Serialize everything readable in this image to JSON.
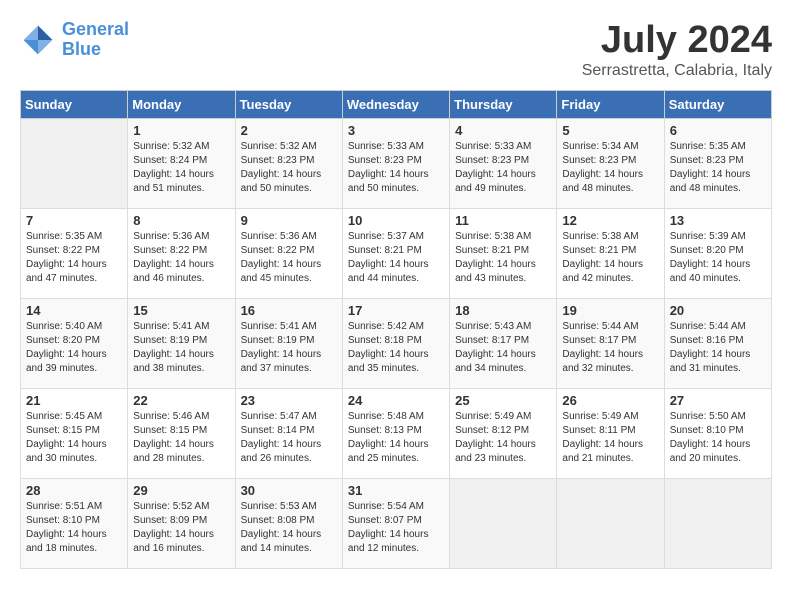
{
  "logo": {
    "line1": "General",
    "line2": "Blue"
  },
  "title": "July 2024",
  "subtitle": "Serrastretta, Calabria, Italy",
  "headers": [
    "Sunday",
    "Monday",
    "Tuesday",
    "Wednesday",
    "Thursday",
    "Friday",
    "Saturday"
  ],
  "weeks": [
    [
      {
        "day": "",
        "info": ""
      },
      {
        "day": "1",
        "info": "Sunrise: 5:32 AM\nSunset: 8:24 PM\nDaylight: 14 hours\nand 51 minutes."
      },
      {
        "day": "2",
        "info": "Sunrise: 5:32 AM\nSunset: 8:23 PM\nDaylight: 14 hours\nand 50 minutes."
      },
      {
        "day": "3",
        "info": "Sunrise: 5:33 AM\nSunset: 8:23 PM\nDaylight: 14 hours\nand 50 minutes."
      },
      {
        "day": "4",
        "info": "Sunrise: 5:33 AM\nSunset: 8:23 PM\nDaylight: 14 hours\nand 49 minutes."
      },
      {
        "day": "5",
        "info": "Sunrise: 5:34 AM\nSunset: 8:23 PM\nDaylight: 14 hours\nand 48 minutes."
      },
      {
        "day": "6",
        "info": "Sunrise: 5:35 AM\nSunset: 8:23 PM\nDaylight: 14 hours\nand 48 minutes."
      }
    ],
    [
      {
        "day": "7",
        "info": "Sunrise: 5:35 AM\nSunset: 8:22 PM\nDaylight: 14 hours\nand 47 minutes."
      },
      {
        "day": "8",
        "info": "Sunrise: 5:36 AM\nSunset: 8:22 PM\nDaylight: 14 hours\nand 46 minutes."
      },
      {
        "day": "9",
        "info": "Sunrise: 5:36 AM\nSunset: 8:22 PM\nDaylight: 14 hours\nand 45 minutes."
      },
      {
        "day": "10",
        "info": "Sunrise: 5:37 AM\nSunset: 8:21 PM\nDaylight: 14 hours\nand 44 minutes."
      },
      {
        "day": "11",
        "info": "Sunrise: 5:38 AM\nSunset: 8:21 PM\nDaylight: 14 hours\nand 43 minutes."
      },
      {
        "day": "12",
        "info": "Sunrise: 5:38 AM\nSunset: 8:21 PM\nDaylight: 14 hours\nand 42 minutes."
      },
      {
        "day": "13",
        "info": "Sunrise: 5:39 AM\nSunset: 8:20 PM\nDaylight: 14 hours\nand 40 minutes."
      }
    ],
    [
      {
        "day": "14",
        "info": "Sunrise: 5:40 AM\nSunset: 8:20 PM\nDaylight: 14 hours\nand 39 minutes."
      },
      {
        "day": "15",
        "info": "Sunrise: 5:41 AM\nSunset: 8:19 PM\nDaylight: 14 hours\nand 38 minutes."
      },
      {
        "day": "16",
        "info": "Sunrise: 5:41 AM\nSunset: 8:19 PM\nDaylight: 14 hours\nand 37 minutes."
      },
      {
        "day": "17",
        "info": "Sunrise: 5:42 AM\nSunset: 8:18 PM\nDaylight: 14 hours\nand 35 minutes."
      },
      {
        "day": "18",
        "info": "Sunrise: 5:43 AM\nSunset: 8:17 PM\nDaylight: 14 hours\nand 34 minutes."
      },
      {
        "day": "19",
        "info": "Sunrise: 5:44 AM\nSunset: 8:17 PM\nDaylight: 14 hours\nand 32 minutes."
      },
      {
        "day": "20",
        "info": "Sunrise: 5:44 AM\nSunset: 8:16 PM\nDaylight: 14 hours\nand 31 minutes."
      }
    ],
    [
      {
        "day": "21",
        "info": "Sunrise: 5:45 AM\nSunset: 8:15 PM\nDaylight: 14 hours\nand 30 minutes."
      },
      {
        "day": "22",
        "info": "Sunrise: 5:46 AM\nSunset: 8:15 PM\nDaylight: 14 hours\nand 28 minutes."
      },
      {
        "day": "23",
        "info": "Sunrise: 5:47 AM\nSunset: 8:14 PM\nDaylight: 14 hours\nand 26 minutes."
      },
      {
        "day": "24",
        "info": "Sunrise: 5:48 AM\nSunset: 8:13 PM\nDaylight: 14 hours\nand 25 minutes."
      },
      {
        "day": "25",
        "info": "Sunrise: 5:49 AM\nSunset: 8:12 PM\nDaylight: 14 hours\nand 23 minutes."
      },
      {
        "day": "26",
        "info": "Sunrise: 5:49 AM\nSunset: 8:11 PM\nDaylight: 14 hours\nand 21 minutes."
      },
      {
        "day": "27",
        "info": "Sunrise: 5:50 AM\nSunset: 8:10 PM\nDaylight: 14 hours\nand 20 minutes."
      }
    ],
    [
      {
        "day": "28",
        "info": "Sunrise: 5:51 AM\nSunset: 8:10 PM\nDaylight: 14 hours\nand 18 minutes."
      },
      {
        "day": "29",
        "info": "Sunrise: 5:52 AM\nSunset: 8:09 PM\nDaylight: 14 hours\nand 16 minutes."
      },
      {
        "day": "30",
        "info": "Sunrise: 5:53 AM\nSunset: 8:08 PM\nDaylight: 14 hours\nand 14 minutes."
      },
      {
        "day": "31",
        "info": "Sunrise: 5:54 AM\nSunset: 8:07 PM\nDaylight: 14 hours\nand 12 minutes."
      },
      {
        "day": "",
        "info": ""
      },
      {
        "day": "",
        "info": ""
      },
      {
        "day": "",
        "info": ""
      }
    ]
  ]
}
